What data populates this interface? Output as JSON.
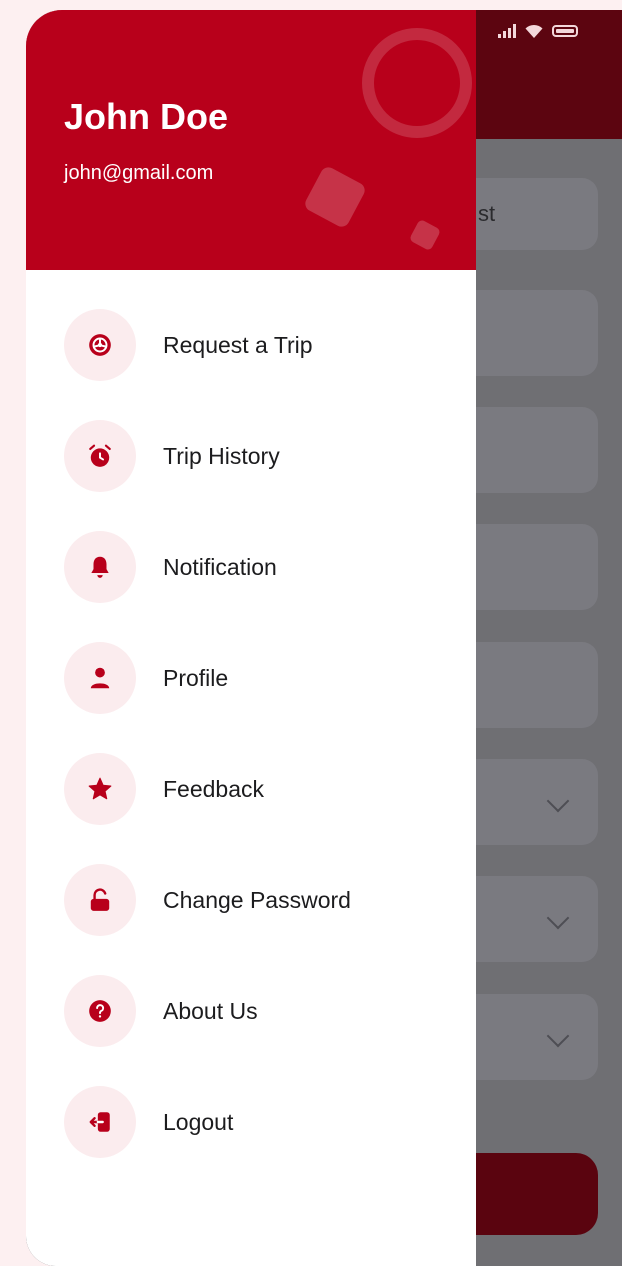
{
  "user": {
    "name": "John Doe",
    "email": "john@gmail.com"
  },
  "background_screen": {
    "partial_text": "st"
  },
  "menu": [
    {
      "label": "Request a Trip",
      "icon": "steering-wheel-icon"
    },
    {
      "label": "Trip History",
      "icon": "alarm-clock-icon"
    },
    {
      "label": "Notification",
      "icon": "bell-icon"
    },
    {
      "label": "Profile",
      "icon": "person-icon"
    },
    {
      "label": "Feedback",
      "icon": "star-icon"
    },
    {
      "label": "Change Password",
      "icon": "unlocked-padlock-icon"
    },
    {
      "label": "About Us",
      "icon": "question-circle-icon"
    },
    {
      "label": "Logout",
      "icon": "logout-icon"
    }
  ],
  "colors": {
    "accent": "#b8001b",
    "icon_bg": "#fbecee",
    "text": "#1c1c1e",
    "page_bg": "#fdf0f1",
    "overlay": "#6f6f73"
  }
}
